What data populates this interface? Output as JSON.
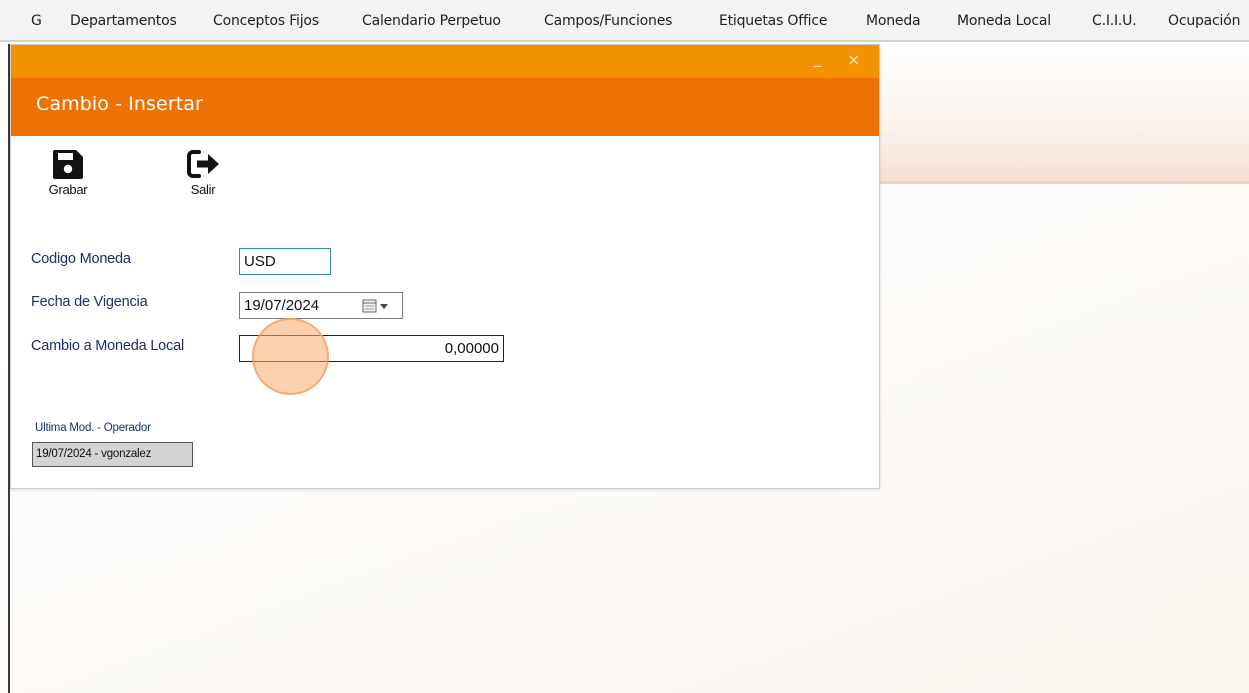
{
  "menu": {
    "items": [
      {
        "label": "G"
      },
      {
        "label": "Departamentos"
      },
      {
        "label": "Conceptos Fijos"
      },
      {
        "label": "Calendario Perpetuo"
      },
      {
        "label": "Campos/Funciones"
      },
      {
        "label": "Etiquetas Office"
      },
      {
        "label": "Moneda"
      },
      {
        "label": "Moneda Local"
      },
      {
        "label": "C.I.I.U."
      },
      {
        "label": "Ocupación"
      }
    ]
  },
  "dialog": {
    "title": "Cambio - Insertar",
    "minimize_glyph": "_",
    "close_glyph": "×",
    "toolbar": {
      "save_label": "Grabar",
      "save_icon": "floppy-disk-icon",
      "exit_label": "Salir",
      "exit_icon": "sign-out-icon"
    },
    "form": {
      "codigo_moneda_label": "Codigo Moneda",
      "codigo_moneda_value": "USD",
      "fecha_vigencia_label": "Fecha de Vigencia",
      "fecha_vigencia_value": "19/07/2024",
      "cambio_label": "Cambio a Moneda Local",
      "cambio_value": "0,00000"
    },
    "last_mod": {
      "label": "Ultima Mod. - Operador",
      "value": "19/07/2024 - vgonzalez"
    }
  },
  "colors": {
    "title_strip": "#f39200",
    "header": "#ee7203",
    "label_text": "#1c2f66",
    "focus_border": "#2f86b5"
  }
}
